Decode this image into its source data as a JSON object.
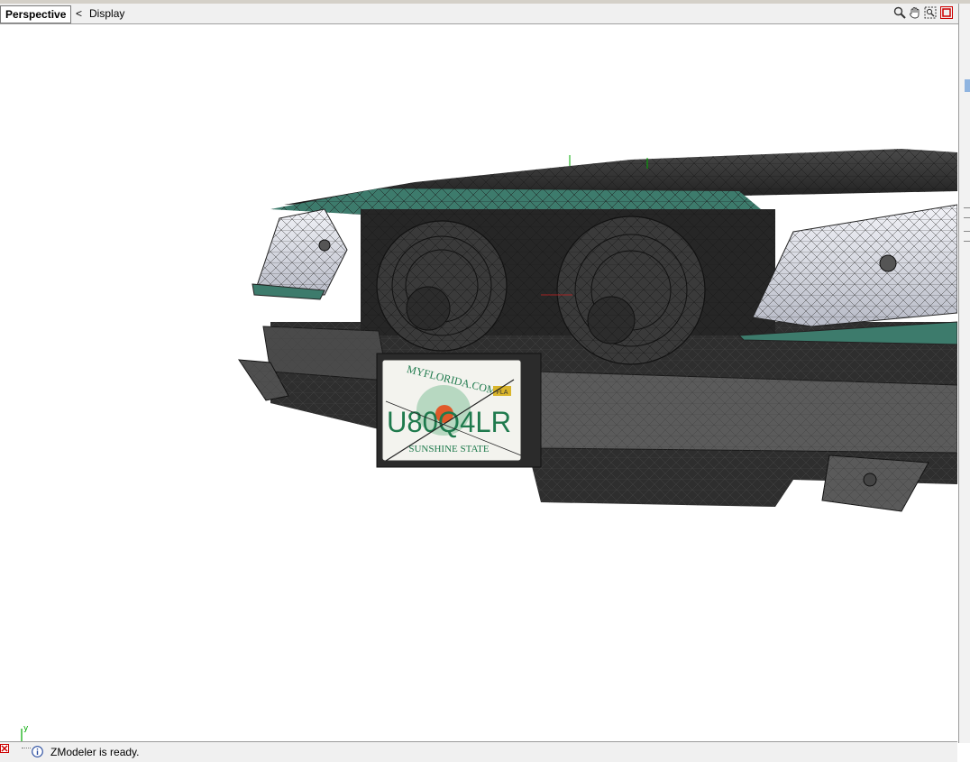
{
  "viewport": {
    "view_name": "Perspective",
    "menu_chevron": "<",
    "menu_label": "Display",
    "tools": [
      "zoom-icon",
      "pan-hand-icon",
      "region-zoom-icon",
      "close-view-icon"
    ]
  },
  "scene": {
    "plate_site": "MYFLORIDA.COM",
    "plate_number": "U80Q4LR",
    "plate_state": "SUNSHINE STATE",
    "plate_sticker": "FLA",
    "axis_labels": {
      "x": "x",
      "y": "y",
      "z": "z"
    }
  },
  "status": {
    "message": "ZModeler is ready."
  },
  "colors": {
    "teal_trim": "#3d7b6c",
    "chrome": "#d8dbe6",
    "body_dark": "#333333",
    "plate_green": "#1f7a4d",
    "close_red": "#cc0000"
  }
}
